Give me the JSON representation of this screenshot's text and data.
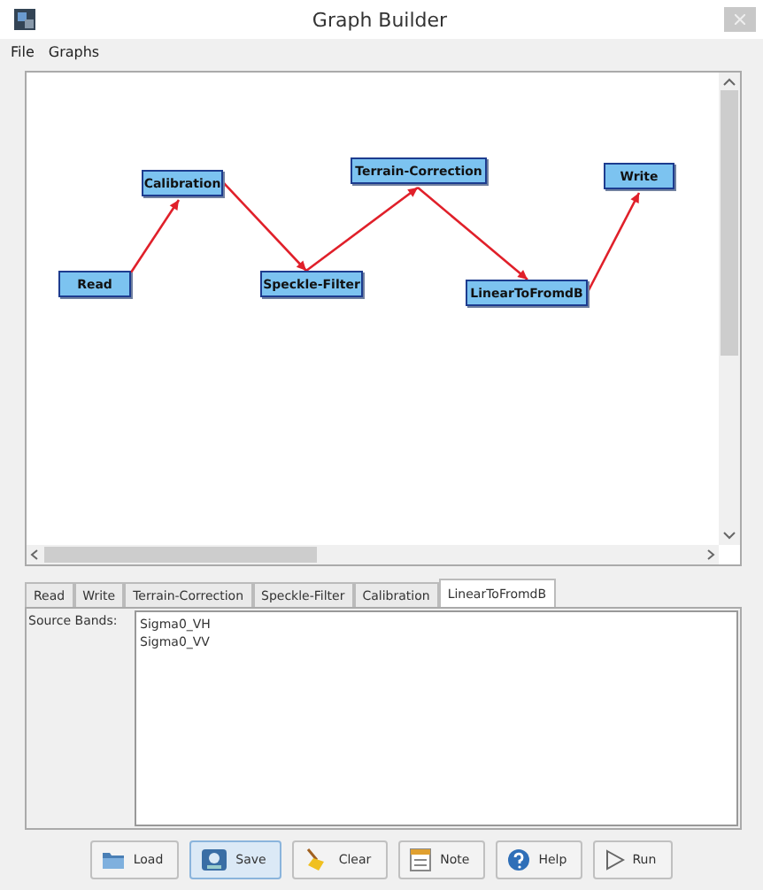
{
  "window": {
    "title": "Graph Builder"
  },
  "menu": [
    "File",
    "Graphs"
  ],
  "graph": {
    "nodes": [
      {
        "label": "Read",
        "linked_to_next": true
      },
      {
        "label": "Calibration",
        "linked_to_next": true
      },
      {
        "label": "Speckle-Filter",
        "linked_to_next": true
      },
      {
        "label": "Terrain-Correction",
        "linked_to_next": true
      },
      {
        "label": "LinearToFromdB",
        "linked_to_next": true
      },
      {
        "label": "Write",
        "linked_to_next": false
      }
    ]
  },
  "tabs": [
    {
      "label": "Read",
      "selected": false
    },
    {
      "label": "Write",
      "selected": false
    },
    {
      "label": "Terrain-Correction",
      "selected": false
    },
    {
      "label": "Speckle-Filter",
      "selected": false
    },
    {
      "label": "Calibration",
      "selected": false
    },
    {
      "label": "LinearToFromdB",
      "selected": true
    }
  ],
  "parameters": {
    "label": "Source Bands:",
    "bands": [
      "Sigma0_VH",
      "Sigma0_VV"
    ]
  },
  "buttons": [
    {
      "label": "Load",
      "kind": "load",
      "highlighted": false
    },
    {
      "label": "Save",
      "kind": "save",
      "highlighted": true
    },
    {
      "label": "Clear",
      "kind": "clear",
      "highlighted": false
    },
    {
      "label": "Note",
      "kind": "note",
      "highlighted": false
    },
    {
      "label": "Help",
      "kind": "help",
      "highlighted": false
    },
    {
      "label": "Run",
      "kind": "run",
      "highlighted": false
    }
  ]
}
